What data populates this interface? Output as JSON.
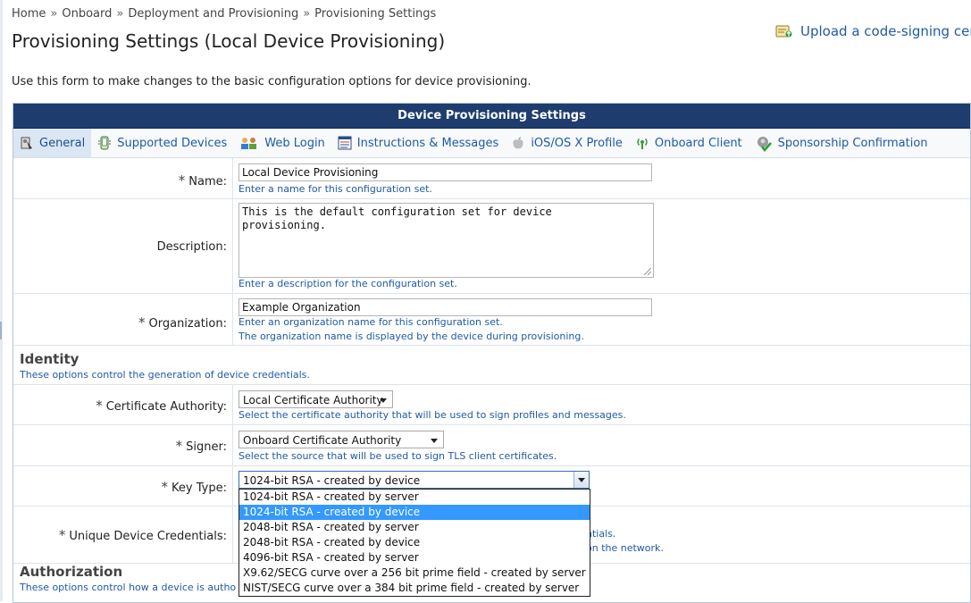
{
  "breadcrumb": {
    "items": [
      "Home",
      "Onboard",
      "Deployment and Provisioning",
      "Provisioning Settings"
    ],
    "separator": "»"
  },
  "page_title": "Provisioning Settings (Local Device Provisioning)",
  "upload_link": {
    "label": "Upload a code-signing cer",
    "icon": "certificate-upload-icon"
  },
  "intro": "Use this form to make changes to the basic configuration options for device provisioning.",
  "panel": {
    "title": "Device Provisioning Settings",
    "tabs": [
      {
        "label": "General",
        "icon": "general-icon"
      },
      {
        "label": "Supported Devices",
        "icon": "phone-icon"
      },
      {
        "label": "Web Login",
        "icon": "users-icon"
      },
      {
        "label": "Instructions & Messages",
        "icon": "list-icon"
      },
      {
        "label": "iOS/OS X Profile",
        "icon": "apple-icon"
      },
      {
        "label": "Onboard Client",
        "icon": "wireless-icon"
      },
      {
        "label": "Sponsorship Confirmation",
        "icon": "sponsor-check-icon"
      }
    ]
  },
  "form": {
    "name": {
      "label": "Name:",
      "required": "*",
      "value": "Local Device Provisioning",
      "help": "Enter a name for this configuration set."
    },
    "description": {
      "label": "Description:",
      "value": "This is the default configuration set for device\nprovisioning.",
      "help": "Enter a description for the configuration set."
    },
    "organization": {
      "label": "Organization:",
      "required": "*",
      "value": "Example Organization",
      "help1": "Enter an organization name for this configuration set.",
      "help2": "The organization name is displayed by the device during provisioning."
    },
    "identity": {
      "title": "Identity",
      "help": "These options control the generation of device credentials."
    },
    "ca": {
      "label": "Certificate Authority:",
      "required": "*",
      "value": "Local Certificate Authority",
      "help": "Select the certificate authority that will be used to sign profiles and messages."
    },
    "signer": {
      "label": "Signer:",
      "required": "*",
      "value": "Onboard Certificate Authority",
      "help": "Select the source that will be used to sign TLS client certificates."
    },
    "key_type": {
      "label": "Key Type:",
      "required": "*",
      "value": "1024-bit RSA - created by device",
      "options": [
        "1024-bit RSA - created by server",
        "1024-bit RSA - created by device",
        "2048-bit RSA - created by server",
        "2048-bit RSA - created by device",
        "4096-bit RSA - created by server",
        "X9.62/SECG curve over a 256 bit prime field - created by server",
        "NIST/SECG curve over a 384 bit prime field - created by server"
      ],
      "selected_index": 1
    },
    "unique_creds": {
      "label": "Unique Device Credentials:",
      "required": "*",
      "help1_tail": "ntials.",
      "help2_tail": "on the network."
    },
    "authorization": {
      "title": "Authorization",
      "help": "These options control how a device is autho"
    }
  },
  "colors": {
    "header_bg": "#1e3d6e",
    "link": "#1f5aa6",
    "selected_option": "#3399ff"
  }
}
